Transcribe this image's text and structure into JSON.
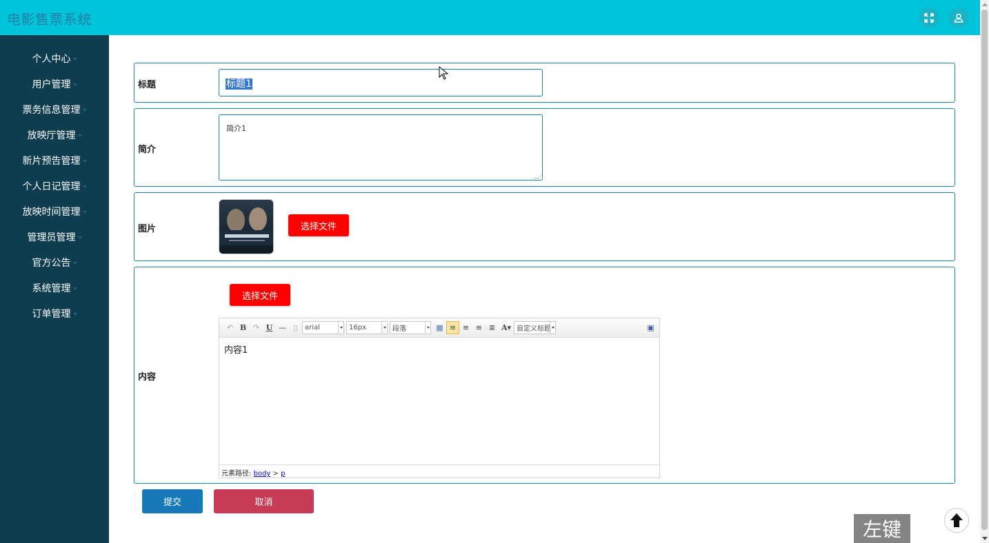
{
  "app": {
    "title": "电影售票系统"
  },
  "header": {
    "fullscreen_icon": "expand-icon",
    "user_icon": "user-icon",
    "accent": "#00c4d9"
  },
  "sidebar": {
    "bg": "#0d3d4f",
    "items": [
      {
        "label": "个人中心"
      },
      {
        "label": "用户管理"
      },
      {
        "label": "票务信息管理"
      },
      {
        "label": "放映厅管理"
      },
      {
        "label": "新片预告管理"
      },
      {
        "label": "个人日记管理"
      },
      {
        "label": "放映时间管理"
      },
      {
        "label": "管理员管理"
      },
      {
        "label": "官方公告"
      },
      {
        "label": "系统管理"
      },
      {
        "label": "订单管理"
      }
    ]
  },
  "form": {
    "title_label": "标题",
    "title_value": "标题1",
    "intro_label": "简介",
    "intro_value": "简介1",
    "image_label": "图片",
    "image_button": "选择文件",
    "content_label": "内容",
    "content_button": "选择文件"
  },
  "editor": {
    "font_family": "arial",
    "font_size": "16px",
    "paragraph": "段落",
    "custom_title": "自定义标题",
    "content": "内容1",
    "status_prefix": "元素路径:",
    "status_body": "body",
    "status_sep": ">",
    "status_p": "p"
  },
  "actions": {
    "submit": "提交",
    "cancel": "取消",
    "submit_color": "#1779b8",
    "cancel_color": "#c73b57"
  },
  "overlay": {
    "watermark": "左键"
  }
}
